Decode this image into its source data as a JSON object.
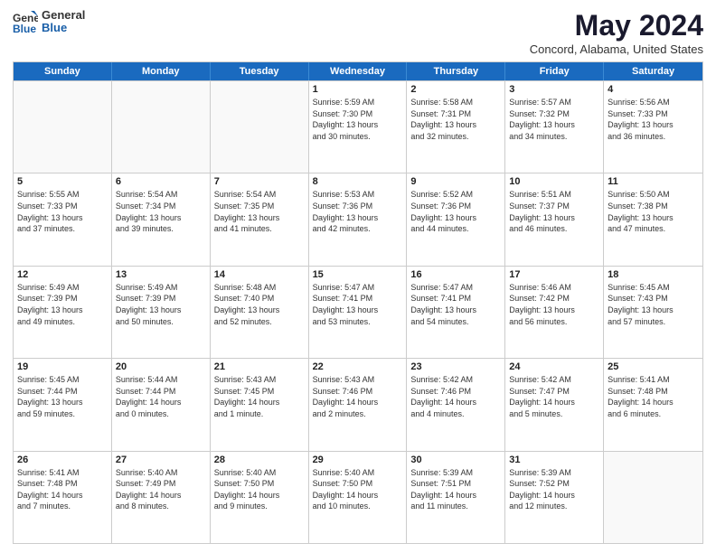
{
  "logo": {
    "general": "General",
    "blue": "Blue"
  },
  "title": "May 2024",
  "location": "Concord, Alabama, United States",
  "header_days": [
    "Sunday",
    "Monday",
    "Tuesday",
    "Wednesday",
    "Thursday",
    "Friday",
    "Saturday"
  ],
  "weeks": [
    [
      {
        "day": "",
        "content": ""
      },
      {
        "day": "",
        "content": ""
      },
      {
        "day": "",
        "content": ""
      },
      {
        "day": "1",
        "content": "Sunrise: 5:59 AM\nSunset: 7:30 PM\nDaylight: 13 hours\nand 30 minutes."
      },
      {
        "day": "2",
        "content": "Sunrise: 5:58 AM\nSunset: 7:31 PM\nDaylight: 13 hours\nand 32 minutes."
      },
      {
        "day": "3",
        "content": "Sunrise: 5:57 AM\nSunset: 7:32 PM\nDaylight: 13 hours\nand 34 minutes."
      },
      {
        "day": "4",
        "content": "Sunrise: 5:56 AM\nSunset: 7:33 PM\nDaylight: 13 hours\nand 36 minutes."
      }
    ],
    [
      {
        "day": "5",
        "content": "Sunrise: 5:55 AM\nSunset: 7:33 PM\nDaylight: 13 hours\nand 37 minutes."
      },
      {
        "day": "6",
        "content": "Sunrise: 5:54 AM\nSunset: 7:34 PM\nDaylight: 13 hours\nand 39 minutes."
      },
      {
        "day": "7",
        "content": "Sunrise: 5:54 AM\nSunset: 7:35 PM\nDaylight: 13 hours\nand 41 minutes."
      },
      {
        "day": "8",
        "content": "Sunrise: 5:53 AM\nSunset: 7:36 PM\nDaylight: 13 hours\nand 42 minutes."
      },
      {
        "day": "9",
        "content": "Sunrise: 5:52 AM\nSunset: 7:36 PM\nDaylight: 13 hours\nand 44 minutes."
      },
      {
        "day": "10",
        "content": "Sunrise: 5:51 AM\nSunset: 7:37 PM\nDaylight: 13 hours\nand 46 minutes."
      },
      {
        "day": "11",
        "content": "Sunrise: 5:50 AM\nSunset: 7:38 PM\nDaylight: 13 hours\nand 47 minutes."
      }
    ],
    [
      {
        "day": "12",
        "content": "Sunrise: 5:49 AM\nSunset: 7:39 PM\nDaylight: 13 hours\nand 49 minutes."
      },
      {
        "day": "13",
        "content": "Sunrise: 5:49 AM\nSunset: 7:39 PM\nDaylight: 13 hours\nand 50 minutes."
      },
      {
        "day": "14",
        "content": "Sunrise: 5:48 AM\nSunset: 7:40 PM\nDaylight: 13 hours\nand 52 minutes."
      },
      {
        "day": "15",
        "content": "Sunrise: 5:47 AM\nSunset: 7:41 PM\nDaylight: 13 hours\nand 53 minutes."
      },
      {
        "day": "16",
        "content": "Sunrise: 5:47 AM\nSunset: 7:41 PM\nDaylight: 13 hours\nand 54 minutes."
      },
      {
        "day": "17",
        "content": "Sunrise: 5:46 AM\nSunset: 7:42 PM\nDaylight: 13 hours\nand 56 minutes."
      },
      {
        "day": "18",
        "content": "Sunrise: 5:45 AM\nSunset: 7:43 PM\nDaylight: 13 hours\nand 57 minutes."
      }
    ],
    [
      {
        "day": "19",
        "content": "Sunrise: 5:45 AM\nSunset: 7:44 PM\nDaylight: 13 hours\nand 59 minutes."
      },
      {
        "day": "20",
        "content": "Sunrise: 5:44 AM\nSunset: 7:44 PM\nDaylight: 14 hours\nand 0 minutes."
      },
      {
        "day": "21",
        "content": "Sunrise: 5:43 AM\nSunset: 7:45 PM\nDaylight: 14 hours\nand 1 minute."
      },
      {
        "day": "22",
        "content": "Sunrise: 5:43 AM\nSunset: 7:46 PM\nDaylight: 14 hours\nand 2 minutes."
      },
      {
        "day": "23",
        "content": "Sunrise: 5:42 AM\nSunset: 7:46 PM\nDaylight: 14 hours\nand 4 minutes."
      },
      {
        "day": "24",
        "content": "Sunrise: 5:42 AM\nSunset: 7:47 PM\nDaylight: 14 hours\nand 5 minutes."
      },
      {
        "day": "25",
        "content": "Sunrise: 5:41 AM\nSunset: 7:48 PM\nDaylight: 14 hours\nand 6 minutes."
      }
    ],
    [
      {
        "day": "26",
        "content": "Sunrise: 5:41 AM\nSunset: 7:48 PM\nDaylight: 14 hours\nand 7 minutes."
      },
      {
        "day": "27",
        "content": "Sunrise: 5:40 AM\nSunset: 7:49 PM\nDaylight: 14 hours\nand 8 minutes."
      },
      {
        "day": "28",
        "content": "Sunrise: 5:40 AM\nSunset: 7:50 PM\nDaylight: 14 hours\nand 9 minutes."
      },
      {
        "day": "29",
        "content": "Sunrise: 5:40 AM\nSunset: 7:50 PM\nDaylight: 14 hours\nand 10 minutes."
      },
      {
        "day": "30",
        "content": "Sunrise: 5:39 AM\nSunset: 7:51 PM\nDaylight: 14 hours\nand 11 minutes."
      },
      {
        "day": "31",
        "content": "Sunrise: 5:39 AM\nSunset: 7:52 PM\nDaylight: 14 hours\nand 12 minutes."
      },
      {
        "day": "",
        "content": ""
      }
    ]
  ]
}
